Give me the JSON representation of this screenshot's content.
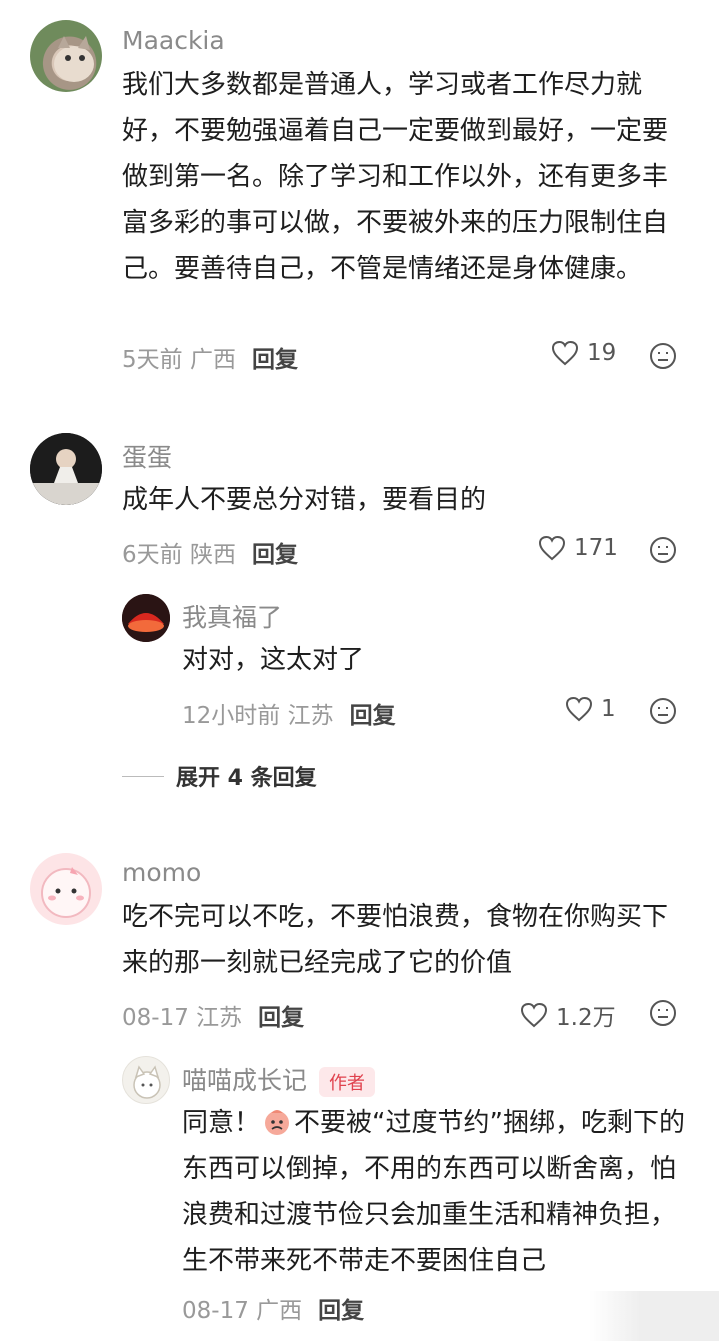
{
  "comments": [
    {
      "username": "Maackia",
      "content": "我们大多数都是普通人，学习或者工作尽力就好，不要勉强逼着自己一定要做到最好，一定要做到第一名。除了学习和工作以外，还有更多丰富多彩的事可以做，不要被外来的压力限制住自己。要善待自己，不管是情绪还是身体健康。",
      "time_location": "5天前 广西",
      "reply_label": "回复",
      "likes": "19"
    },
    {
      "username": "蛋蛋",
      "content": "成年人不要总分对错，要看目的",
      "time_location": "6天前 陕西",
      "reply_label": "回复",
      "likes": "171",
      "reply": {
        "username": "我真福了",
        "content": "对对，这太对了",
        "time_location": "12小时前 江苏",
        "reply_label": "回复",
        "likes": "1"
      },
      "expand_label": "展开 4 条回复"
    },
    {
      "username": "momo",
      "content": "吃不完可以不吃，不要怕浪费，食物在你购买下来的那一刻就已经完成了它的价值",
      "time_location": "08-17 江苏",
      "reply_label": "回复",
      "likes": "1.2万",
      "reply": {
        "username": "喵喵成长记",
        "author_tag": "作者",
        "content_prefix": "同意！",
        "content": "不要被“过度节约”捆绑，吃剩下的东西可以倒掉，不用的东西可以断舍离，怕浪费和过渡节俭只会加重生活和精神负担，生不带来死不带走不要困住自己",
        "time_location": "08-17 广西",
        "reply_label": "回复"
      }
    }
  ]
}
